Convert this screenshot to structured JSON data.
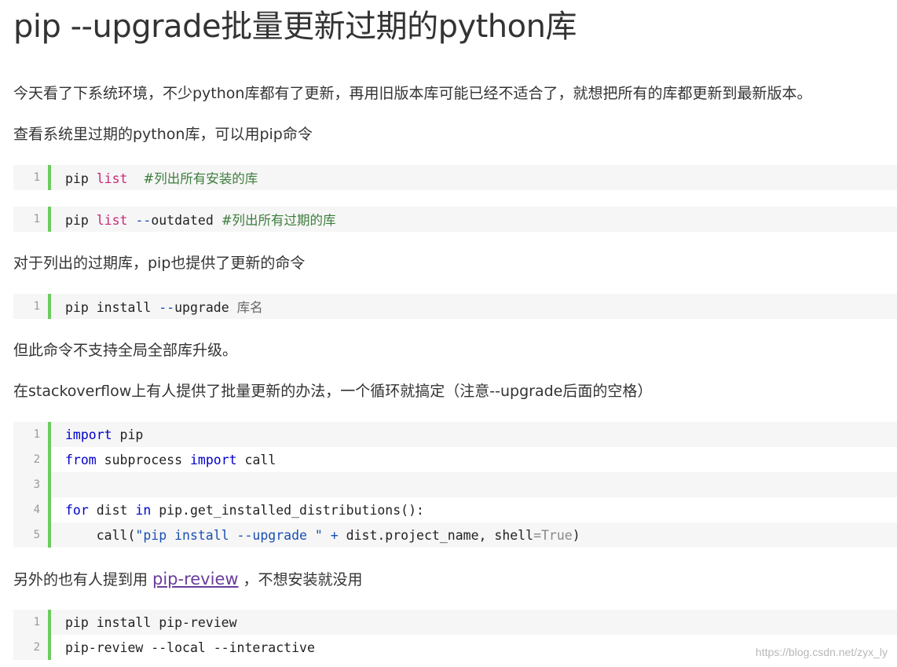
{
  "title": "pip --upgrade批量更新过期的python库",
  "paragraphs": {
    "p1": "今天看了下系统环境，不少python库都有了更新，再用旧版本库可能已经不适合了，就想把所有的库都更新到最新版本。",
    "p2": "查看系统里过期的python库，可以用pip命令",
    "p3": "对于列出的过期库，pip也提供了更新的命令",
    "p4": "但此命令不支持全局全部库升级。",
    "p5": "在stackoverflow上有人提供了批量更新的办法，一个循环就搞定（注意--upgrade后面的空格）",
    "p6_before": "另外的也有人提到用",
    "p6_link": "pip-review",
    "p6_after": "，不想安装就没用"
  },
  "code1": {
    "ln": "1",
    "t0": "pip ",
    "t1": "list",
    "t2": "  ",
    "t3": "#列出所有安装的库"
  },
  "code2": {
    "ln": "1",
    "t0": "pip ",
    "t1": "list",
    "t2": " ",
    "t3": "--",
    "t4": "outdated ",
    "t5": "#列出所有过期的库"
  },
  "code3": {
    "ln": "1",
    "t0": "pip install ",
    "t1": "--",
    "t2": "upgrade ",
    "t3": "库名"
  },
  "code4": {
    "lines": [
      {
        "ln": "1"
      },
      {
        "ln": "2"
      },
      {
        "ln": "3"
      },
      {
        "ln": "4"
      },
      {
        "ln": "5"
      }
    ],
    "l1": {
      "kw": "import",
      "rest": " pip"
    },
    "l2": {
      "kw1": "from",
      "mid": " subprocess ",
      "kw2": "import",
      "rest": " call"
    },
    "l4": {
      "kw1": "for",
      "mid": " dist ",
      "kw2": "in",
      "rest": " pip.get_installed_distributions():"
    },
    "l5": {
      "pre": "    call(",
      "str": "\"pip install --upgrade \"",
      "mid": " ",
      "op": "+",
      "post": " dist.project_name, shell",
      "eq": "=",
      "val": "True",
      "close": ")"
    }
  },
  "code5": {
    "lines": [
      {
        "ln": "1",
        "text": "pip install pip-review"
      },
      {
        "ln": "2",
        "text": "pip-review --local --interactive"
      }
    ]
  },
  "watermark": "https://blog.csdn.net/zyx_ly"
}
